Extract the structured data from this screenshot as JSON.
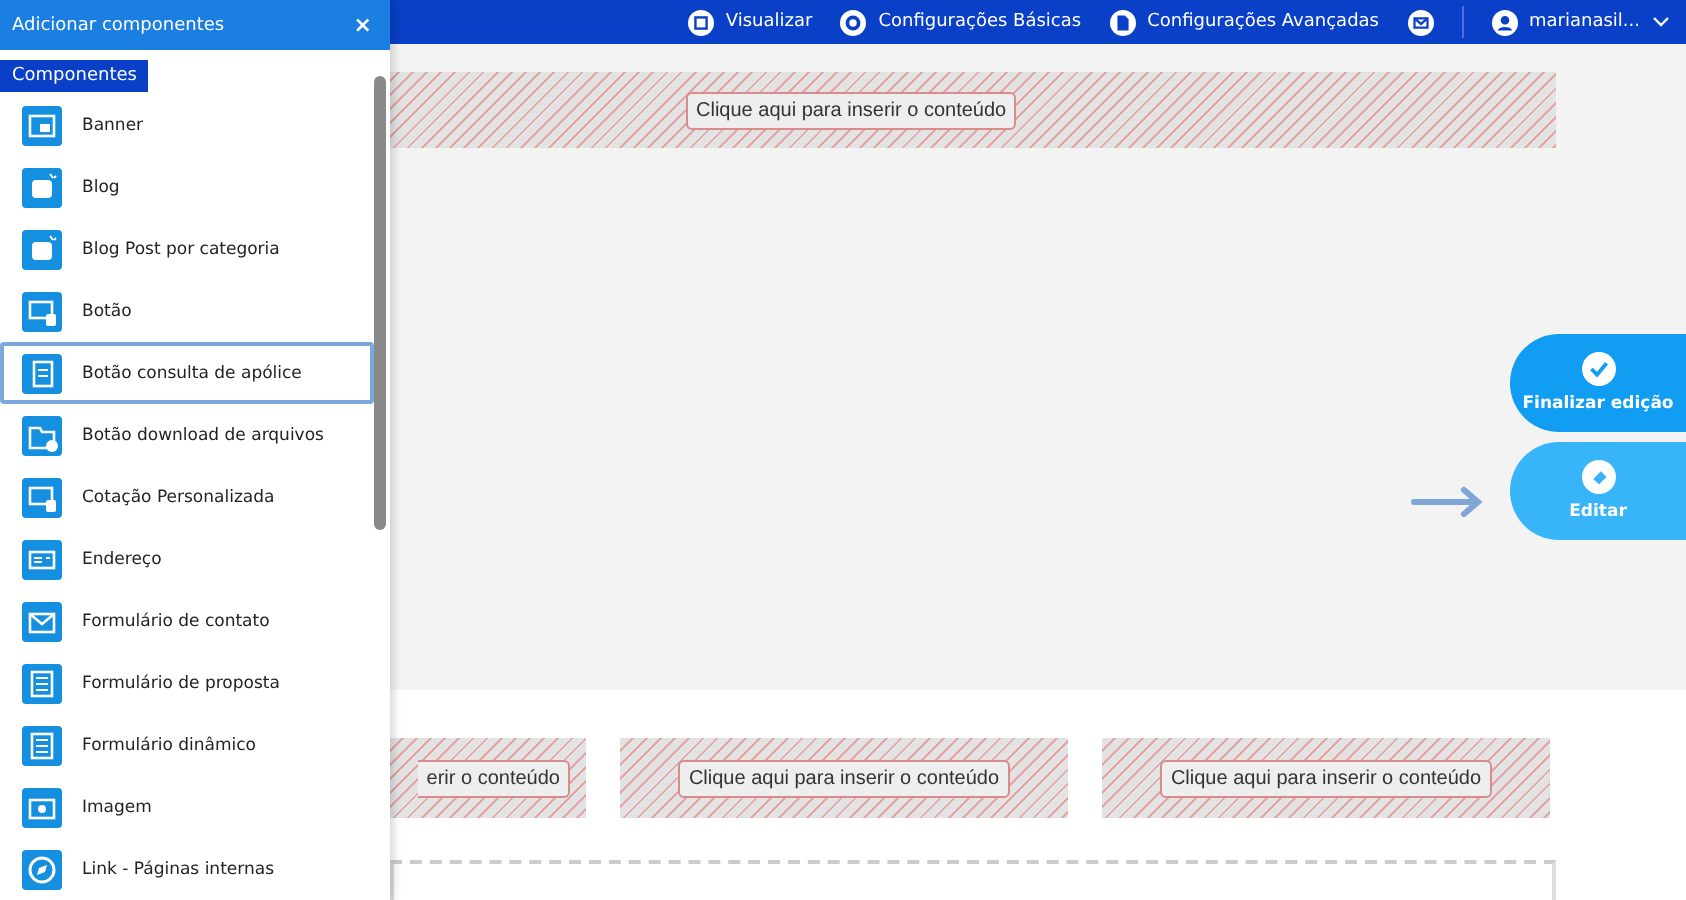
{
  "topbar": {
    "items": [
      {
        "kind": "view",
        "label": "Visualizar"
      },
      {
        "kind": "gear",
        "label": "Configurações Básicas"
      },
      {
        "kind": "doc",
        "label": "Configurações Avançadas"
      },
      {
        "kind": "mail"
      }
    ],
    "user": "marianasil..."
  },
  "canvas": {
    "top_placeholder": "Clique aqui para inserir o conteúdo",
    "row_placeholders": [
      "erir o conteúdo",
      "Clique aqui para inserir o conteúdo",
      "Clique aqui para inserir o conteúdo"
    ]
  },
  "actions": [
    {
      "kind": "check",
      "label": "Finalizar edição"
    },
    {
      "kind": "edit",
      "label": "Editar"
    }
  ],
  "panel": {
    "title": "Adicionar componentes",
    "close": "×",
    "tab": "Componentes",
    "items": [
      {
        "label": "Banner",
        "kind": "banner",
        "selected": false
      },
      {
        "label": "Blog",
        "kind": "blog",
        "selected": false
      },
      {
        "label": "Blog Post por categoria",
        "kind": "blog",
        "selected": false
      },
      {
        "label": "Botão",
        "kind": "screen",
        "selected": false
      },
      {
        "label": "Botão consulta de apólice",
        "kind": "doc",
        "selected": true
      },
      {
        "label": "Botão download de arquivos",
        "kind": "folder",
        "selected": false
      },
      {
        "label": "Cotação Personalizada",
        "kind": "screen",
        "selected": false
      },
      {
        "label": "Endereço",
        "kind": "card",
        "selected": false
      },
      {
        "label": "Formulário de contato",
        "kind": "mail",
        "selected": false
      },
      {
        "label": "Formulário de proposta",
        "kind": "form",
        "selected": false
      },
      {
        "label": "Formulário dinâmico",
        "kind": "form",
        "selected": false
      },
      {
        "label": "Imagem",
        "kind": "image",
        "selected": false
      },
      {
        "label": "Link - Páginas internas",
        "kind": "compass",
        "selected": false
      }
    ]
  }
}
